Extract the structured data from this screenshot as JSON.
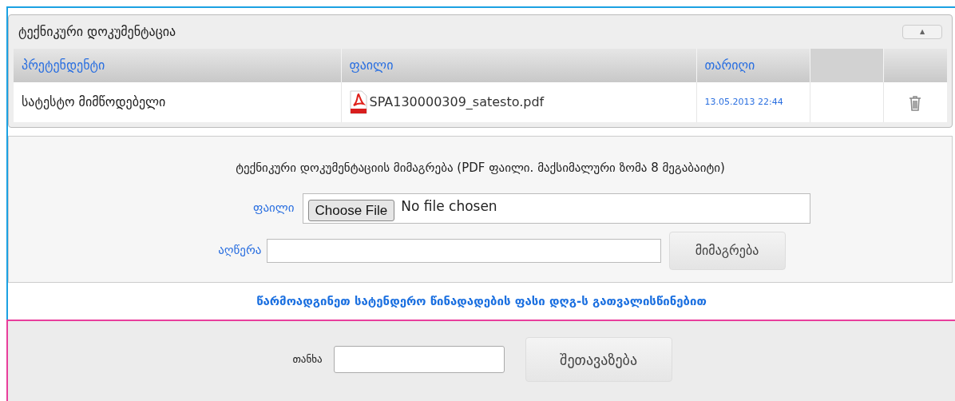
{
  "documents_panel": {
    "title": "ტექნიკური დოკუმენტაცია",
    "collapse_button": "▲",
    "table": {
      "columns": [
        "პრეტენდენტი",
        "ფაილი",
        "თარიღი"
      ],
      "rows": [
        {
          "bidder": "სატესტო მიმწოდებელი",
          "file": "SPA130000309_satesto.pdf",
          "date": "13.05.2013 22:44"
        }
      ]
    }
  },
  "upload_panel": {
    "instruction": "ტექნიკური დოკუმენტაციის მიმაგრება (PDF ფაილი. მაქსიმალური ზომა 8 მეგაბაიტი)",
    "file_label": "ფაილი",
    "choose_button": "Choose File",
    "file_status": "No file chosen",
    "description_label": "აღწერა",
    "attach_button": "მიმაგრება"
  },
  "notice": "წარმოადგინეთ სატენდერო წინადადების ფასი დღგ-ს გათვალისწინებით",
  "offer_panel": {
    "amount_label": "თანხა",
    "submit_button": "შეთავაზება"
  }
}
